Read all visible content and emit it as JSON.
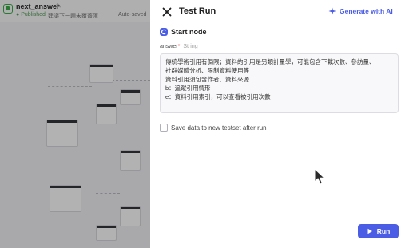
{
  "background": {
    "app_title": "next_answer",
    "status": "Published",
    "description": "建議下一題未覆蓋匯",
    "autosave": "Auto-saved"
  },
  "panel": {
    "title": "Test Run",
    "generate_ai_label": "Generate with AI",
    "start_node_label": "Start node",
    "field": {
      "name": "answer",
      "required_mark": "*",
      "type": "String",
      "value_lines": [
        "傳統學術引用有侷限；資料的引用是另類計量學，可能包含下載次數、參訪量、",
        "社群媒體分析、限制資料使用等",
        "資料引用須包含作者、資料來源",
        "b：追蹤引用情形",
        "e：資料引用索引，可以查看被引用次數"
      ]
    },
    "save_testset_label": "Save data to new testset after run",
    "save_testset_checked": false,
    "run_label": "Run"
  },
  "colors": {
    "accent": "#4b5de4",
    "published": "#3cae4a",
    "required": "#e04a4a"
  },
  "icons": {
    "close": "close-icon",
    "sparkle": "sparkle-icon",
    "start": "start-node-icon",
    "run": "play-icon"
  }
}
